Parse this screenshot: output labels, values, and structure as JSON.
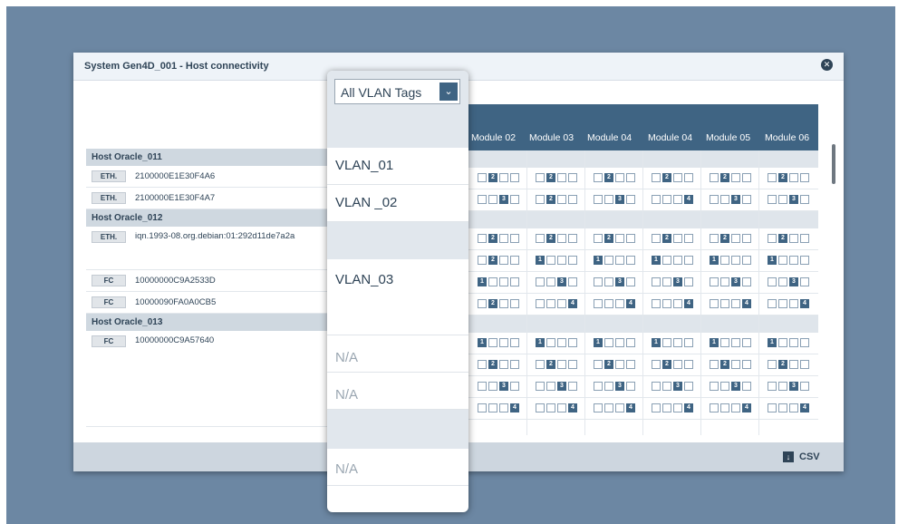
{
  "modal": {
    "title": "System Gen4D_001 - Host connectivity",
    "close_glyph": "✕",
    "csv_label": "CSV",
    "csv_glyph": "↓"
  },
  "dropdown": {
    "selected": "All VLAN Tags",
    "caret_glyph": "⌄",
    "options": [
      "VLAN_01",
      "VLAN _02",
      "VLAN_03",
      "N/A",
      "N/A",
      "N/A"
    ]
  },
  "modules": [
    "Module 02",
    "Module 03",
    "Module 04",
    "Module 04",
    "Module 05",
    "Module 06"
  ],
  "hosts": [
    {
      "name": "Host Oracle_011",
      "ports": [
        {
          "type": "ETH.",
          "address": "2100000E1E30F4A6"
        },
        {
          "type": "ETH.",
          "address": "2100000E1E30F4A7"
        }
      ]
    },
    {
      "name": "Host Oracle_012",
      "ports": [
        {
          "type": "ETH.",
          "address": "iqn.1993-08.org.debian:01:292d11de7a2a"
        },
        {
          "type": "FC",
          "address": "10000000C9A2533D"
        },
        {
          "type": "FC",
          "address": "10000090FA0A0CB5"
        }
      ]
    },
    {
      "name": "Host Oracle_013",
      "ports": [
        {
          "type": "FC",
          "address": "10000000C9A57640"
        }
      ]
    }
  ],
  "grid": {
    "rows": [
      {
        "band": true
      },
      {
        "cells": [
          2,
          2,
          2,
          2,
          2,
          2
        ]
      },
      {
        "cells": [
          3,
          2,
          3,
          4,
          3,
          3
        ]
      },
      {
        "band": true
      },
      {
        "cells": [
          2,
          2,
          2,
          2,
          2,
          2
        ]
      },
      {
        "cells": [
          2,
          1,
          1,
          1,
          1,
          1
        ]
      },
      {
        "cells": [
          1,
          3,
          3,
          3,
          3,
          3
        ]
      },
      {
        "cells": [
          2,
          4,
          4,
          4,
          4,
          4
        ]
      },
      {
        "band": true
      },
      {
        "cells": [
          1,
          1,
          1,
          1,
          1,
          1
        ]
      },
      {
        "cells": [
          2,
          2,
          2,
          2,
          2,
          2
        ]
      },
      {
        "cells": [
          3,
          3,
          3,
          3,
          3,
          3
        ]
      },
      {
        "cells": [
          4,
          4,
          4,
          4,
          4,
          4
        ]
      }
    ]
  }
}
